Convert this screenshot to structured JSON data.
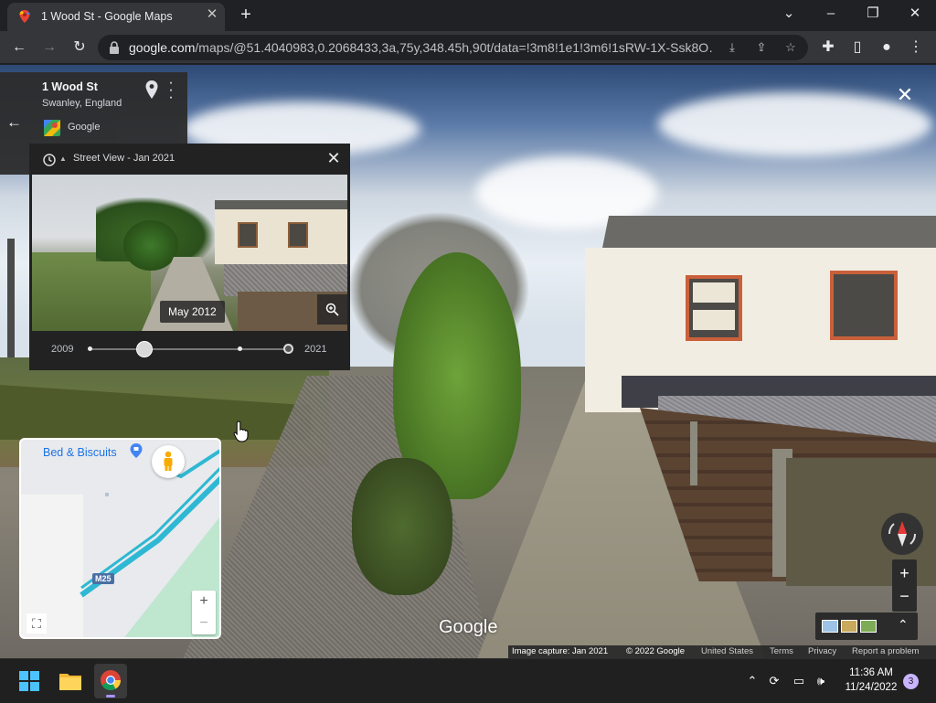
{
  "browser": {
    "tab_title": "1 Wood St - Google Maps",
    "url_host": "google.com",
    "url_path": "/maps/@51.4040983,0.2068433,3a,75y,348.45h,90t/data=!3m8!1e1!3m6!1sRW-1X-Ssk8O…",
    "window_controls": {
      "minimize": "–",
      "restore": "❐",
      "close": "✕",
      "tab_menu": "⌄"
    }
  },
  "place_card": {
    "name": "1 Wood St",
    "locality": "Swanley, England",
    "source": "Google"
  },
  "time_machine": {
    "title": "Street View - Jan 2021",
    "photo_date": "May 2012",
    "start_year": "2009",
    "end_year": "2021",
    "selected_fraction": 0.28
  },
  "minimap": {
    "poi_label": "Bed & Biscuits",
    "road_shield": "M25",
    "zoom_in": "+",
    "zoom_out": "−"
  },
  "controls": {
    "zoom_in": "+",
    "zoom_out": "−",
    "watermark": "Google",
    "layers_chevron": "⌃"
  },
  "footer": {
    "image_capture": "Image capture: Jan 2021",
    "copyright": "© 2022 Google",
    "region": "United States",
    "terms": "Terms",
    "privacy": "Privacy",
    "report": "Report a problem"
  },
  "taskbar": {
    "time": "11:36 AM",
    "date": "11/24/2022",
    "notification_count": "3"
  },
  "colors": {
    "accent_map_blue": "#1a73e8",
    "slider_thumb": "#d8d8d8",
    "window_frame": "#c9603a",
    "taskbar_indicator": "#a794ff"
  }
}
